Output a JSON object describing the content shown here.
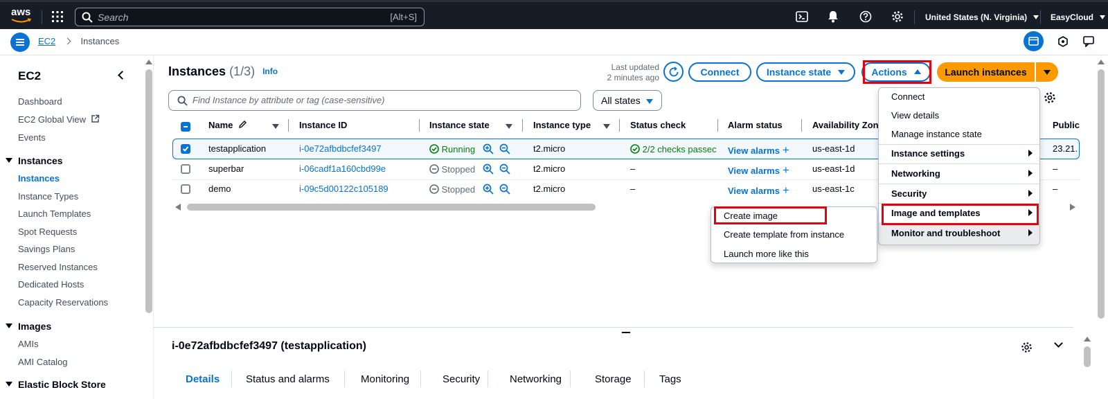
{
  "topnav": {
    "logo": "aws",
    "search_placeholder": "Search",
    "search_shortcut": "[Alt+S]",
    "region": "United States (N. Virginia)",
    "account": "EasyCloud"
  },
  "breadcrumb": {
    "root": "EC2",
    "current": "Instances"
  },
  "sidebar": {
    "title": "EC2",
    "top_items": [
      "Dashboard",
      "EC2 Global View",
      "Events"
    ],
    "sections": [
      {
        "title": "Instances",
        "items": [
          "Instances",
          "Instance Types",
          "Launch Templates",
          "Spot Requests",
          "Savings Plans",
          "Reserved Instances",
          "Dedicated Hosts",
          "Capacity Reservations"
        ]
      },
      {
        "title": "Images",
        "items": [
          "AMIs",
          "AMI Catalog"
        ]
      },
      {
        "title": "Elastic Block Store",
        "items": []
      }
    ]
  },
  "header": {
    "title": "Instances",
    "count": "(1/3)",
    "info": "Info",
    "last_updated_label": "Last updated",
    "last_updated_value": "2 minutes ago",
    "connect": "Connect",
    "instance_state": "Instance state",
    "actions": "Actions",
    "launch": "Launch instances"
  },
  "filter": {
    "placeholder": "Find Instance by attribute or tag (case-sensitive)",
    "state_select": "All states"
  },
  "table": {
    "columns": [
      "Name",
      "Instance ID",
      "Instance state",
      "Instance type",
      "Status check",
      "Alarm status",
      "Availability Zon",
      "Public"
    ],
    "rows": [
      {
        "selected": true,
        "name": "testapplication",
        "id": "i-0e72afbdbcfef3497",
        "state": "Running",
        "type": "t2.micro",
        "status": "2/2 checks passec",
        "alarm": "View alarms",
        "az": "us-east-1d",
        "public": "23.21."
      },
      {
        "selected": false,
        "name": "superbar",
        "id": "i-06cadf1a160cbd99e",
        "state": "Stopped",
        "type": "t2.micro",
        "status": "–",
        "alarm": "View alarms",
        "az": "us-east-1d",
        "public": "–"
      },
      {
        "selected": false,
        "name": "demo",
        "id": "i-09c5d00122c105189",
        "state": "Stopped",
        "type": "t2.micro",
        "status": "–",
        "alarm": "View alarms",
        "az": "us-east-1c",
        "public": "–"
      }
    ]
  },
  "actions_menu": {
    "items": [
      "Connect",
      "View details",
      "Manage instance state"
    ],
    "submenus": [
      "Instance settings",
      "Networking",
      "Security",
      "Image and templates",
      "Monitor and troubleshoot"
    ]
  },
  "image_submenu": {
    "items": [
      "Create image",
      "Create template from instance",
      "Launch more like this"
    ]
  },
  "details": {
    "title": "i-0e72afbdbcfef3497 (testapplication)",
    "tabs": [
      "Details",
      "Status and alarms",
      "Monitoring",
      "Security",
      "Networking",
      "Storage",
      "Tags"
    ]
  },
  "colors": {
    "accent": "#0972d3",
    "brand": "#ff9900",
    "nav": "#161d26",
    "running": "#037f0c",
    "stopped": "#5f6b7a",
    "highlight": "#e3000f"
  }
}
